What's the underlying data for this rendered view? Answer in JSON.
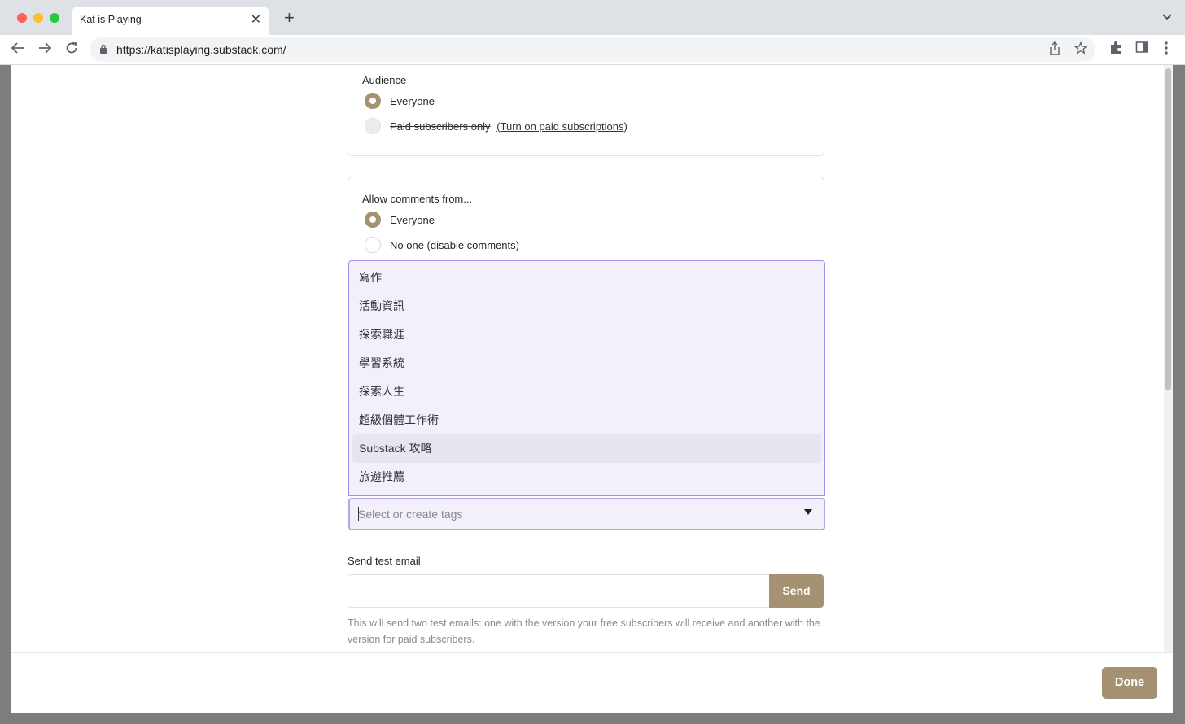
{
  "browser": {
    "tab_title": "Kat is Playing",
    "url": "https://katisplaying.substack.com/"
  },
  "audience": {
    "label": "Audience",
    "options": [
      {
        "label": "Everyone",
        "checked": true
      },
      {
        "label": "Paid subscribers only",
        "link": "(Turn on paid subscriptions)",
        "disabled": true
      }
    ]
  },
  "comments": {
    "label": "Allow comments from...",
    "options": [
      {
        "label": "Everyone",
        "checked": true
      },
      {
        "label": "No one (disable comments)",
        "checked": false
      }
    ]
  },
  "tags": {
    "options": [
      "寫作",
      "活動資訊",
      "探索職涯",
      "學習系統",
      "探索人生",
      "超級個體工作術",
      "Substack 攻略",
      "旅遊推薦"
    ],
    "highlighted": "Substack 攻略",
    "placeholder": "Select or create tags"
  },
  "test_email": {
    "title": "Send test email",
    "send_label": "Send",
    "help": "This will send two test emails: one with the version your free subscribers will receive and another with the version for paid subscribers."
  },
  "footer": {
    "done_label": "Done"
  },
  "colors": {
    "accent": "#a59273",
    "dropdown_bg": "#f3f0fc",
    "dropdown_border": "#a48cf0"
  }
}
